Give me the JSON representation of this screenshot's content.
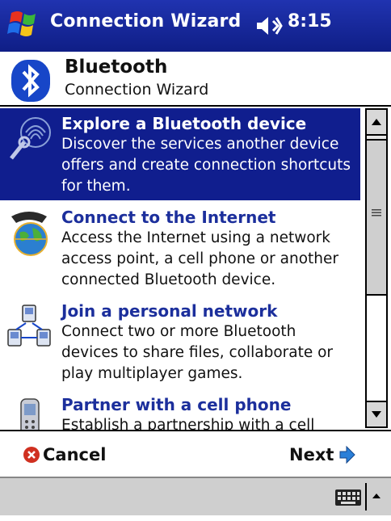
{
  "titlebar": {
    "app_title": "Connection Wizard",
    "clock": "8:15",
    "color": "#14249a"
  },
  "header": {
    "title": "Bluetooth",
    "subtitle": "Connection Wizard"
  },
  "list": {
    "items": [
      {
        "title": "Explore a Bluetooth device",
        "description": "Discover the services another device offers and create connection shortcuts for them.",
        "icon": "fingerprint-search-icon",
        "selected": true
      },
      {
        "title": "Connect to the Internet",
        "description": "Access the Internet using a network access point, a cell phone or another connected Bluetooth device.",
        "icon": "globe-phone-icon",
        "selected": false
      },
      {
        "title": "Join a personal network",
        "description": "Connect two or more Bluetooth devices to share files, collaborate or play multiplayer games.",
        "icon": "network-devices-icon",
        "selected": false
      },
      {
        "title": "Partner with a cell phone",
        "description": "Establish a partnership with a cell",
        "icon": "cell-phone-icon",
        "selected": false
      }
    ]
  },
  "navbar": {
    "cancel_label": "Cancel",
    "next_label": "Next"
  },
  "colors": {
    "selection": "#101e8e",
    "link_title": "#1c2f9c",
    "cancel_icon": "#d03020",
    "next_arrow": "#2a7fd8"
  }
}
